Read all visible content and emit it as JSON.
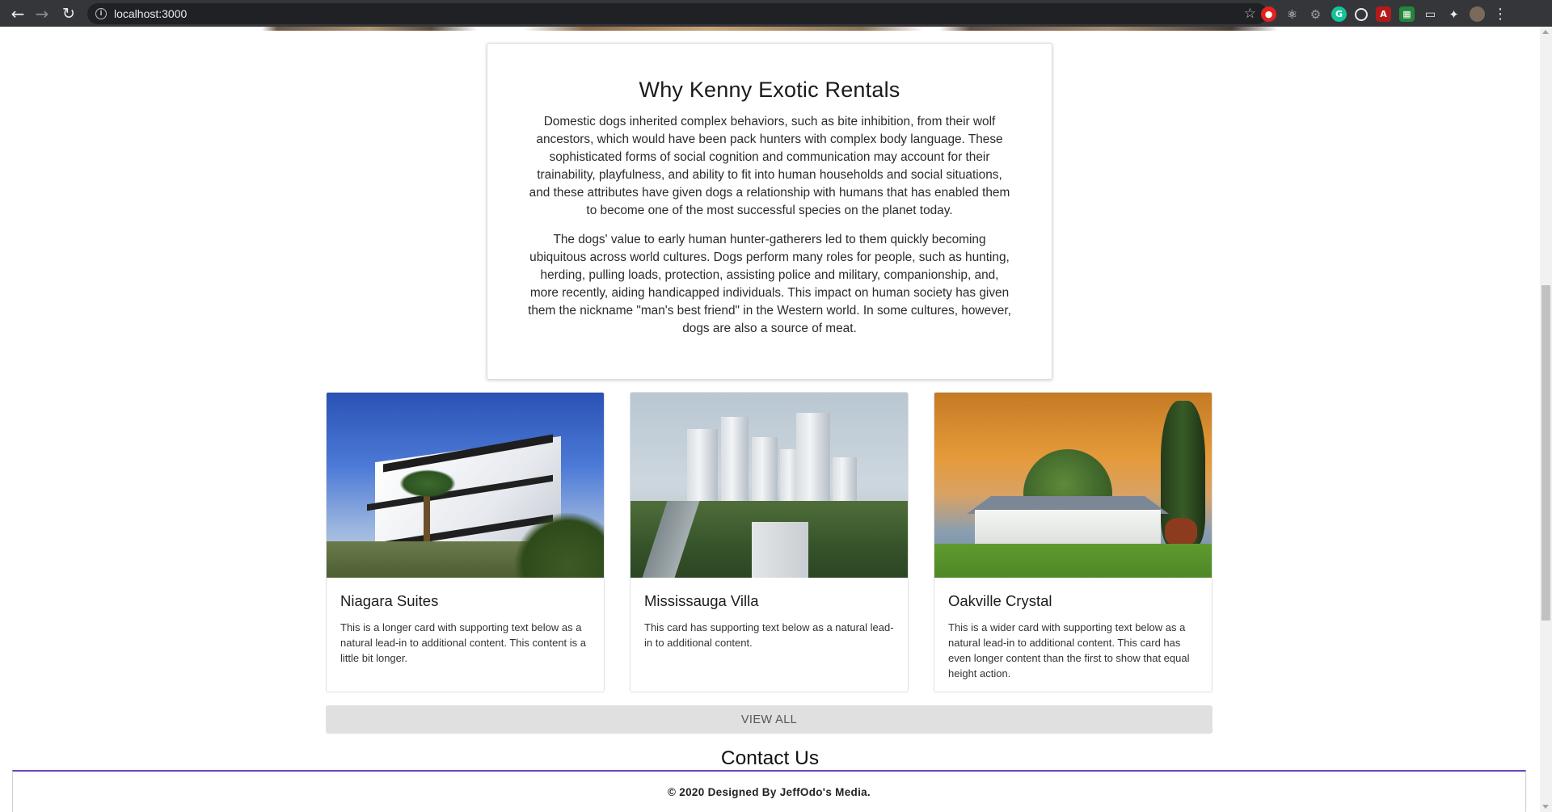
{
  "browser": {
    "url": "localhost:3000",
    "icons": {
      "back": "back-arrow-icon",
      "forward": "forward-arrow-icon",
      "reload": "reload-icon",
      "info": "info-icon",
      "bookmark": "star-icon",
      "extensions": "puzzle-icon",
      "menu": "kebab-menu-icon"
    },
    "extension_colors": [
      "#e5211e",
      "#3d3d3d",
      "#707070",
      "#15c39a",
      "#5f6368",
      "#b31b1b",
      "#23863a",
      "#5f6368"
    ]
  },
  "why": {
    "title": "Why Kenny Exotic Rentals",
    "paragraph_1": "Domestic dogs inherited complex behaviors, such as bite inhibition, from their wolf ancestors, which would have been pack hunters with complex body language. These sophisticated forms of social cognition and communication may account for their trainability, playfulness, and ability to fit into human households and social situations, and these attributes have given dogs a relationship with humans that has enabled them to become one of the most successful species on the planet today.",
    "paragraph_2": "The dogs' value to early human hunter-gatherers led to them quickly becoming ubiquitous across world cultures. Dogs perform many roles for people, such as hunting, herding, pulling loads, protection, assisting police and military, companionship, and, more recently, aiding handicapped individuals. This impact on human society has given them the nickname \"man's best friend\" in the Western world. In some cultures, however, dogs are also a source of meat."
  },
  "cards": [
    {
      "title": "Niagara Suites",
      "text": "This is a longer card with supporting text below as a natural lead-in to additional content. This content is a little bit longer."
    },
    {
      "title": "Mississauga Villa",
      "text": "This card has supporting text below as a natural lead-in to additional content."
    },
    {
      "title": "Oakville Crystal",
      "text": "This is a wider card with supporting text below as a natural lead-in to additional content. This card has even longer content than the first to show that equal height action."
    }
  ],
  "view_all_label": "VIEW ALL",
  "contact_title": "Contact Us",
  "footer_text": "© 2020 Designed By JeffOdo's Media.",
  "colors": {
    "footer_accent": "#6f42c1",
    "button_bg": "#e0e0e0"
  }
}
